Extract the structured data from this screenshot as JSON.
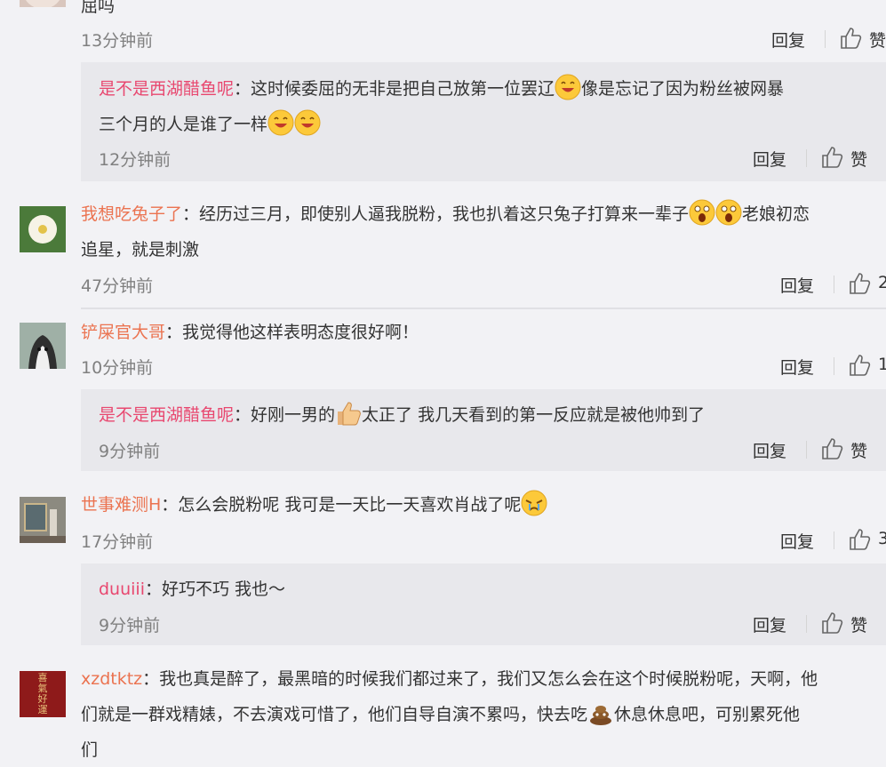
{
  "top_comment": {
    "text_tail": "屈吗",
    "time": "13分钟前",
    "reply_label": "回复",
    "like_label": "赞",
    "sub_reply": {
      "user": "是不是西湖醋鱼呢",
      "line1_a": "：这时候委屈的无非是把自己放第一位罢辽",
      "line1_b": "像是忘记了因为粉丝被网暴",
      "line2": "三个月的人是谁了一样",
      "time": "12分钟前",
      "reply_label": "回复",
      "like_label": "赞"
    }
  },
  "comments": [
    {
      "user": "我想吃兔子了",
      "line1_a": "：经历过三月，即使别人逼我脱粉，我也扒着这只兔子打算来一辈子",
      "line1_b": "老娘初恋",
      "line2": "追星，就是刺激",
      "time": "47分钟前",
      "reply_label": "回复",
      "like_count": "2"
    },
    {
      "user": "铲屎官大哥",
      "text": "：我觉得他这样表明态度很好啊！",
      "time": "10分钟前",
      "reply_label": "回复",
      "like_count": "1",
      "sub_reply": {
        "user": "是不是西湖醋鱼呢",
        "text_a": "：好刚一男的",
        "text_b": "太正了 我几天看到的第一反应就是被他帅到了",
        "time": "9分钟前",
        "reply_label": "回复",
        "like_label": "赞"
      }
    },
    {
      "user": "世事难测H",
      "text": "：怎么会脱粉呢  我可是一天比一天喜欢肖战了呢",
      "time": "17分钟前",
      "reply_label": "回复",
      "like_count": "3",
      "sub_reply": {
        "user": "duuiii",
        "text": "：好巧不巧 我也～",
        "time": "9分钟前",
        "reply_label": "回复",
        "like_label": "赞"
      }
    },
    {
      "user": "xzdtktz",
      "line1": "：我也真是醉了，最黑暗的时候我们都过来了，我们又怎么会在这个时候脱粉呢，天啊，他",
      "line2_a": "们就是一群戏精婊，不去演戏可惜了，他们自导自演不累吗，快去吃",
      "line2_b": "休息休息吧，可别累死他",
      "line3": "们",
      "avatar_text": "喜\n氣\n好\n運"
    }
  ],
  "colors": {
    "username": "#eb7350",
    "username_reply": "#e8476f",
    "time": "#808080",
    "sub_box_bg": "#e8e8ec"
  }
}
